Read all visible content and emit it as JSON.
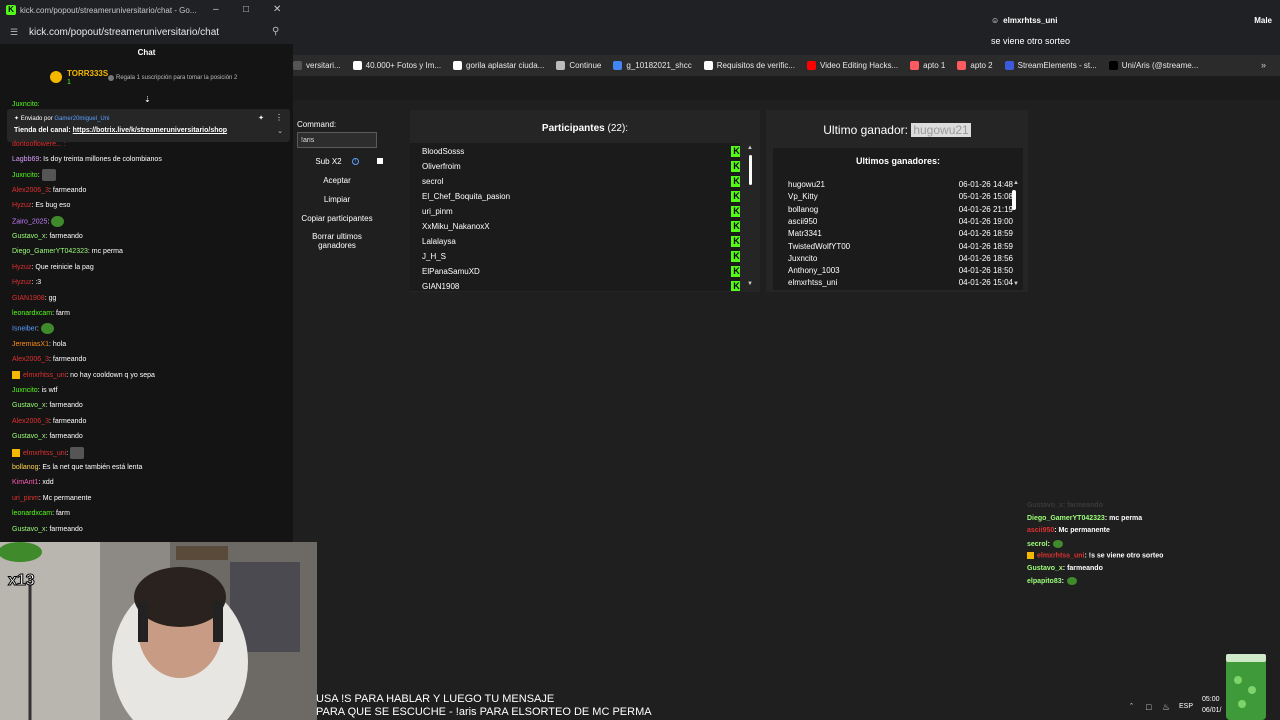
{
  "popout": {
    "title": "kick.com/popout/streameruniversitario/chat - Go...",
    "url": "kick.com/popout/streameruniversitario/chat",
    "header": "Chat",
    "sub_banner": {
      "user": "TORR333S",
      "sub_count": "1",
      "text": "Regala 1 suscripción para tomar la posición 2"
    },
    "pinned": {
      "sent_by_label": "Enviado por",
      "sent_by_user": "Gamer20miguel_Uni",
      "message_prefix": "Tienda del canal:",
      "link": "https://botrix.live/k/streameruniversitario/shop"
    },
    "top_partial_user": "Juxncito:",
    "cut_user": "doritooflowere... :",
    "messages": [
      {
        "user": "Lagbb69",
        "color": "#d99cff",
        "text": ": Is doy treinta millones de colombianos"
      },
      {
        "user": "Juxncito",
        "color": "#53fc18",
        "text": ":",
        "emote": "emote"
      },
      {
        "user": "Alex2006_3",
        "color": "#e03030",
        "text": ": farmeando"
      },
      {
        "user": "Hyzuz",
        "color": "#e03030",
        "text": ": Es bug eso"
      },
      {
        "user": "Zairo_2025",
        "color": "#c77dff",
        "text": ":",
        "emote": "pepe"
      },
      {
        "user": "Gustavo_x",
        "color": "#9cff7a",
        "text": ": farmeando"
      },
      {
        "user": "Diego_GamerYT042323",
        "color": "#9cff7a",
        "text": ": mc perma"
      },
      {
        "user": "Hyzuz",
        "color": "#e03030",
        "text": ": Que reinicie la pag"
      },
      {
        "user": "Hyzuz",
        "color": "#e03030",
        "text": ": :3"
      },
      {
        "user": "GIAN1908",
        "color": "#e03030",
        "text": ": gg"
      },
      {
        "user": "leonardxcam",
        "color": "#53fc18",
        "text": ": farm"
      },
      {
        "user": "Isneiber",
        "color": "#5aa0ff",
        "text": ":",
        "emote": "pepe"
      },
      {
        "user": "JeremiasX1",
        "color": "#ff8c1a",
        "text": ": hola"
      },
      {
        "user": "Alex2006_3",
        "color": "#e03030",
        "text": ": farmeando"
      },
      {
        "user": "elmxrhtss_uni",
        "color": "#e03030",
        "text": ": no hay cooldown q yo sepa",
        "badge": true
      },
      {
        "user": "Juxncito",
        "color": "#53fc18",
        "text": ": is wtf"
      },
      {
        "user": "Gustavo_x",
        "color": "#9cff7a",
        "text": ": farmeando"
      },
      {
        "user": "Alex2006_3",
        "color": "#e03030",
        "text": ": farmeando"
      },
      {
        "user": "Gustavo_x",
        "color": "#9cff7a",
        "text": ": farmeando"
      },
      {
        "user": "elmxrhtss_uni",
        "color": "#e03030",
        "text": ":",
        "emote": "emote",
        "badge": true
      },
      {
        "user": "bollanog",
        "color": "#ffd34d",
        "text": ": Es la net que también está lenta"
      },
      {
        "user": "KimAnt1",
        "color": "#ff5ab4",
        "text": ": xdd"
      },
      {
        "user": "uri_pinm",
        "color": "#e03030",
        "text": ": Mc permanente"
      },
      {
        "user": "leonardxcam",
        "color": "#53fc18",
        "text": ": farm"
      },
      {
        "user": "Gustavo_x",
        "color": "#9cff7a",
        "text": ": farmeando"
      }
    ]
  },
  "topbar": {
    "user": "elmxrhtss_uni",
    "right_label": "Male",
    "message": "se viene otro sorteo"
  },
  "bookmarks": [
    {
      "label": "versitari...",
      "color": "#555555"
    },
    {
      "label": "40.000+ Fotos y Im...",
      "color": "#ffffff"
    },
    {
      "label": "gorila aplastar ciuda...",
      "color": "#ffffff"
    },
    {
      "label": "Continue",
      "color": "#bbbbbb"
    },
    {
      "label": "g_10182021_shcc",
      "color": "#4285f4"
    },
    {
      "label": "Requisitos de verific...",
      "color": "#ffffff"
    },
    {
      "label": "Video Editing Hacks...",
      "color": "#ff0000"
    },
    {
      "label": "apto 1",
      "color": "#ff5a5f"
    },
    {
      "label": "apto 2",
      "color": "#ff5a5f"
    },
    {
      "label": "StreamElements - st...",
      "color": "#3b5bdb"
    },
    {
      "label": "Uni/Aris (@streame...",
      "color": "#000000"
    }
  ],
  "app": {
    "command_label": "Command:",
    "command_value": "!aris",
    "sub_label": "Sub X2",
    "buttons": [
      "Aceptar",
      "Limpiar",
      "Copiar participantes",
      "Borrar ultimos ganadores"
    ],
    "participants_title": "Participantes",
    "participants_count": "(22):",
    "participants": [
      "BloodSosss",
      "Oliverfroim",
      "secrol",
      "El_Chef_Boquita_pasion",
      "uri_pinm",
      "XxMiku_NakanoxX",
      "Lalalaysa",
      "J_H_S",
      "ElPanaSamuXD",
      "GIAN1908"
    ],
    "last_winner_label": "Ultimo ganador:",
    "last_winner": "hugowu21",
    "winners_title": "Ultimos ganadores:",
    "winners": [
      {
        "name": "hugowu21",
        "date": "06-01-26 14:48"
      },
      {
        "name": "Vp_Kitty",
        "date": "05-01-26 15:08"
      },
      {
        "name": "bollanog",
        "date": "04-01-26 21:19"
      },
      {
        "name": "ascii950",
        "date": "04-01-26 19:00"
      },
      {
        "name": "Matr3341",
        "date": "04-01-26 18:59"
      },
      {
        "name": "TwistedWolfYT00",
        "date": "04-01-26 18:59"
      },
      {
        "name": "Juxncito",
        "date": "04-01-26 18:56"
      },
      {
        "name": "Anthony_1003",
        "date": "04-01-26 18:50"
      },
      {
        "name": "elmxrhtss_uni",
        "date": "04-01-26 15:04"
      }
    ]
  },
  "overlay_chat": [
    {
      "user": "Gustavo_x",
      "color": "#3a3a3a",
      "text": ": farmeando"
    },
    {
      "user": "Diego_GamerYT042323",
      "color": "#9cff7a",
      "text": ": mc perma"
    },
    {
      "user": "ascii950",
      "color": "#e03030",
      "text": ": Mc permanente"
    },
    {
      "user": "secrol",
      "color": "#9cff7a",
      "text": ":",
      "emote": true
    },
    {
      "user": "elmxrhtss_uni",
      "color": "#e03030",
      "text": ": !s se viene otro sorteo",
      "badge": true
    },
    {
      "user": "Gustavo_x",
      "color": "#9cff7a",
      "text": ": farmeando"
    },
    {
      "user": "elpapito83",
      "color": "#9cff7a",
      "text": ":",
      "emote": true
    }
  ],
  "cam": {
    "overlay_text": "x13"
  },
  "subtitles": {
    "line1": "USA !S PARA HABLAR Y LUEGO TU MENSAJE",
    "line2": "PARA QUE SE ESCUCHE - !aris PARA ELSORTEO DE MC PERMA"
  },
  "taskbar": {
    "lang": "ESP",
    "time": "05:00",
    "date": "06/01/"
  }
}
